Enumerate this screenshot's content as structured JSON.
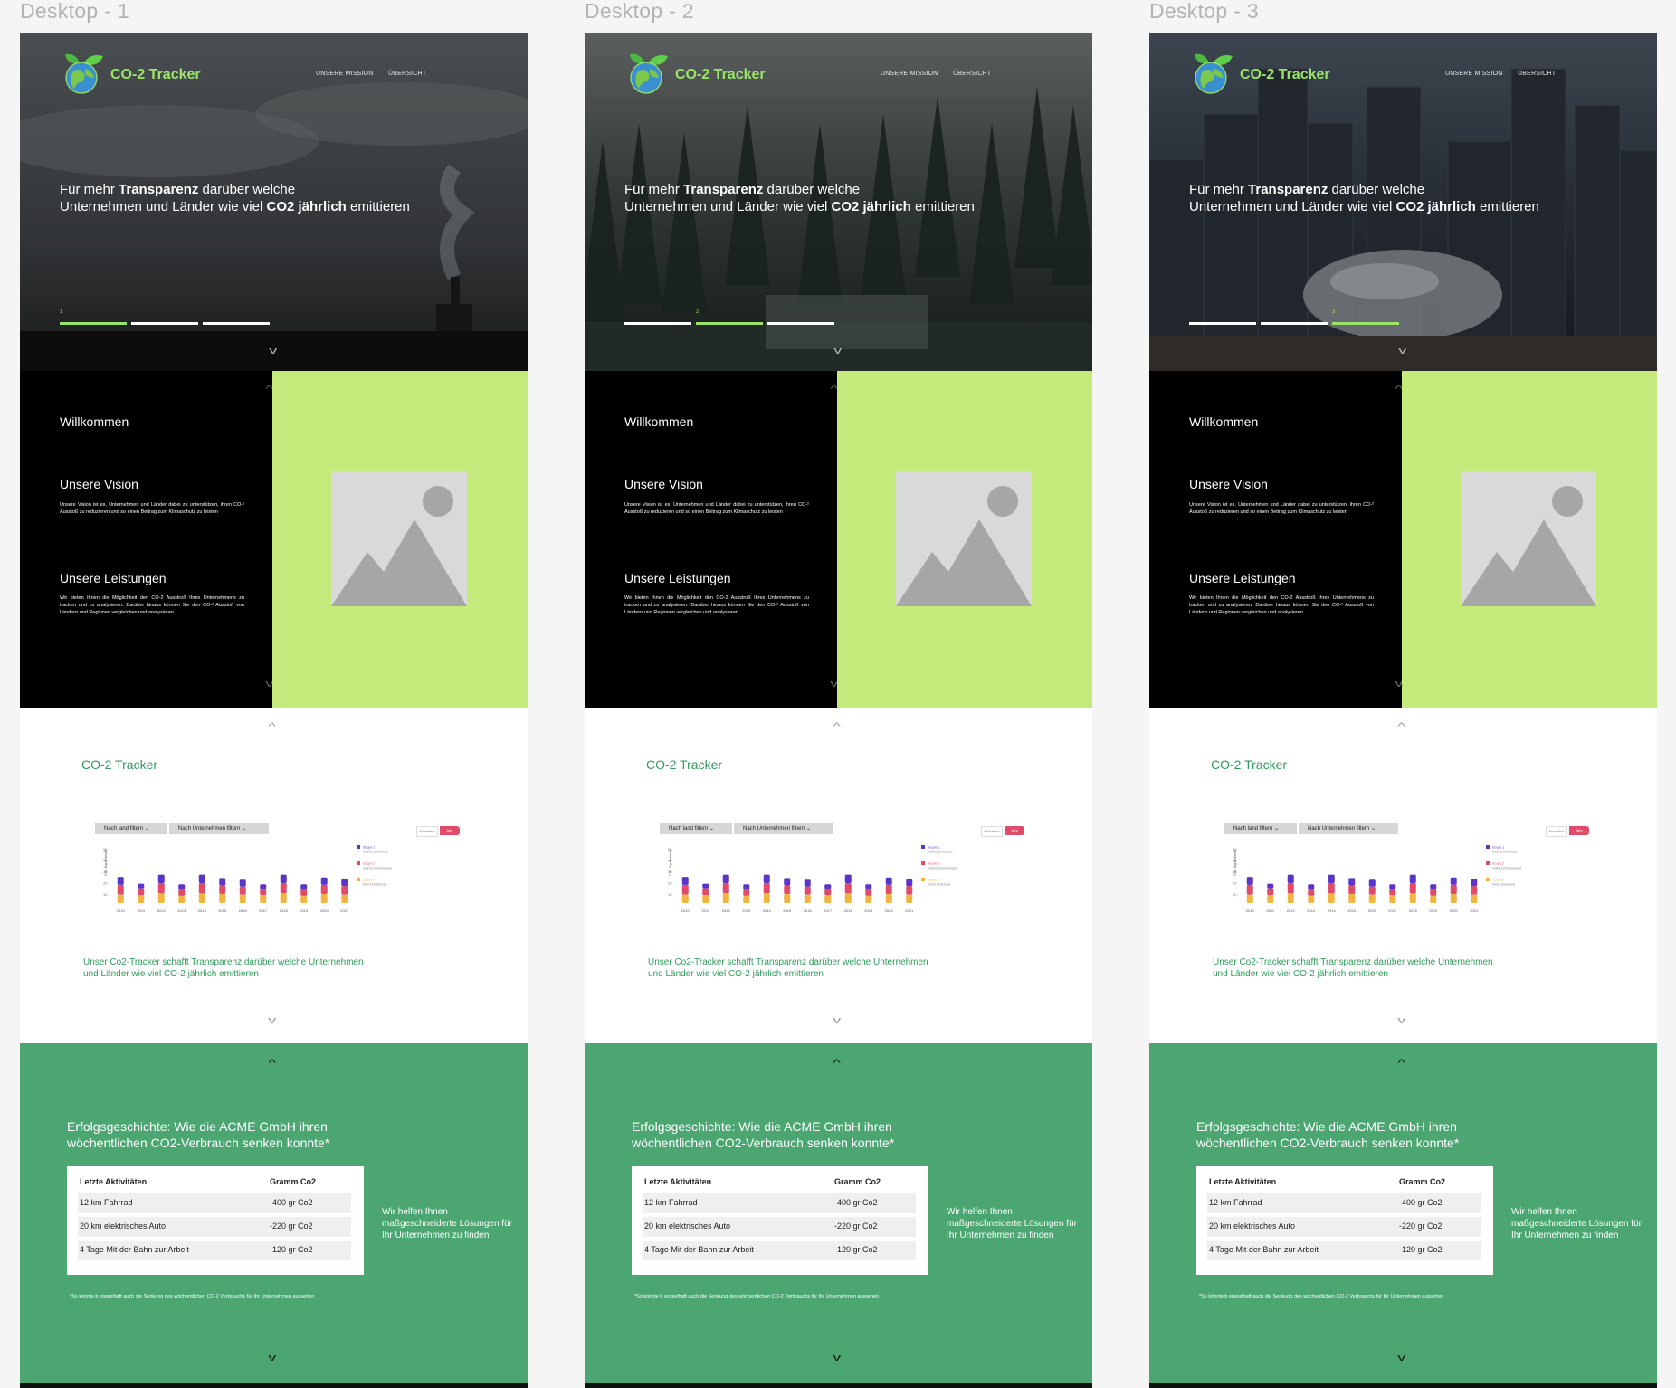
{
  "frames": [
    {
      "title": "Desktop - 1",
      "active_slide": 0,
      "hero_theme": "smokestack",
      "slide_number": "1",
      "stray_char": "’"
    },
    {
      "title": "Desktop - 2",
      "active_slide": 1,
      "hero_theme": "forest",
      "slide_number": "2",
      "stray_char": "’"
    },
    {
      "title": "Desktop - 3",
      "active_slide": 2,
      "hero_theme": "city",
      "slide_number": "3",
      "stray_char": "’"
    }
  ],
  "brand": "CO-2 Tracker",
  "nav": {
    "mission": "UNSERE MISSION",
    "overview": "ÜBERSICHT"
  },
  "hero": {
    "line1_pre": "Für mehr ",
    "line1_bold": "Transparenz",
    "line1_post": " darüber welche",
    "line2_pre": "Unternehmen und Länder wie viel ",
    "line2_bold": "CO2 jährlich",
    "line2_post": " emittieren"
  },
  "about": {
    "welcome": "Willkommen",
    "vision_title": "Unsere Vision",
    "vision_text": "Unsere Vision ist es, Unternehmen und Länder dabei zu unterstützen, ihren CO-² Ausstoß zu reduzieren und so einen Beitrag zum Klimaschutz zu leisten",
    "services_title": "Unsere Leistungen",
    "services_text": "Wir bieten Ihnen die Möglichkeit den CO-2 Ausstroß Ihres Unternehmens zu tracken und zu analysieren. Darüber hinaus können Sie den CO-² Ausstoß von Ländern und Regionen vergleichen und analysieren."
  },
  "tracker": {
    "title": "CO-2 Tracker",
    "filter_country": "Nach land filtern ⌄",
    "filter_company": "Nach Unternehmen filtern ⌄",
    "toggle_monthly": "Monatlich",
    "toggle_yearly": "Jahr",
    "ylabel": "Co2 Äquivalente",
    "description": "Unser Co2-Tracker schafft Transparenz darüber welche Unternehmen und Länder wie viel CO-2 jährlich emittieren"
  },
  "chart_data": {
    "type": "bar",
    "stacked": true,
    "categories": [
      "2010",
      "2011",
      "2012",
      "2013",
      "2014",
      "2015",
      "2016",
      "2017",
      "2018",
      "2019",
      "2020",
      "2021"
    ],
    "yticks": [
      "50",
      "40",
      "30",
      "20",
      "10"
    ],
    "ylim": [
      0,
      50
    ],
    "series": [
      {
        "name": "Scope 3",
        "sub": "Direct Emissions",
        "color": "#f0b440",
        "values": [
          15,
          14,
          17,
          13,
          17,
          16,
          15,
          14,
          17,
          13,
          16,
          15
        ]
      },
      {
        "name": "Scope 2",
        "sub": "Indirect (Grid energy)",
        "color": "#e04b6a",
        "values": [
          17,
          12,
          18,
          11,
          18,
          15,
          14,
          11,
          18,
          12,
          16,
          15
        ]
      },
      {
        "name": "Scope 1",
        "sub": "Indirect Emissions",
        "color": "#5b35c8",
        "values": [
          14,
          8,
          15,
          9,
          15,
          13,
          12,
          8,
          15,
          8,
          13,
          12
        ]
      }
    ],
    "legend_position": "right"
  },
  "success": {
    "title": "Erfolgsgeschichte: Wie die ACME GmbH ihren wöchentlichen CO2-Verbrauch senken konnte*",
    "col1": "Letzte Aktivitäten",
    "col2": "Gramm Co2",
    "rows": [
      {
        "activity": "12 km Fahrrad",
        "value": "-400 gr Co2"
      },
      {
        "activity": "20 km elektrisches Auto",
        "value": "-220 gr Co2"
      },
      {
        "activity": "4 Tage Mit der Bahn zur Arbeit",
        "value": "-120 gr Co2"
      }
    ],
    "help": "Wir helfen Ihnen maßgeschneiderte Lösungen für Ihr Unternehmen zu finden",
    "footnote": "*So könnte b eispielhaft auch die Senkung des wöchentlichen CO-2 Verbrauchs für Ihr Unternehmen aussehen"
  }
}
